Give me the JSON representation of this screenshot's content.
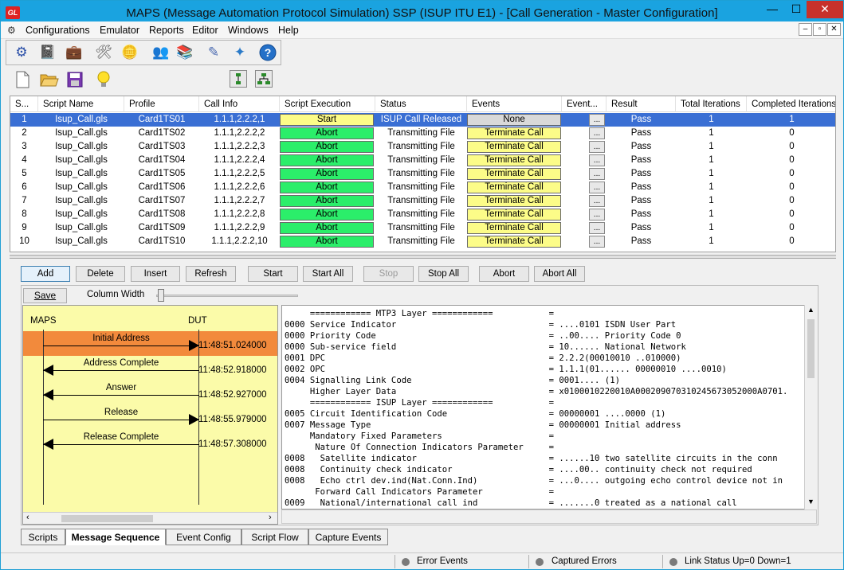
{
  "window": {
    "app_icon": "GL",
    "title": "MAPS (Message Automation Protocol Simulation) SSP (ISUP ITU E1) - [Call Generation - Master Configuration]",
    "min": "—",
    "max": "☐",
    "close": "✕"
  },
  "menu": {
    "items": [
      "Configurations",
      "Emulator",
      "Reports",
      "Editor",
      "Windows",
      "Help"
    ],
    "mdi": [
      "–",
      "▫",
      "✕"
    ]
  },
  "toolbar1": [
    "gear-icon",
    "notebook-icon",
    "briefcase-icon",
    "tools-icon",
    "coins-icon",
    "users-icon",
    "books-icon",
    "edit-icon",
    "wizard-icon",
    "help-icon"
  ],
  "toolbar2": [
    "new-file-icon",
    "open-folder-icon",
    "save-icon",
    "lightbulb-icon",
    "tree-single-icon",
    "tree-multi-icon"
  ],
  "grid": {
    "headers": [
      "S...",
      "Script Name",
      "Profile",
      "Call Info",
      "Script Execution",
      "Status",
      "Events",
      "Event...",
      "Result",
      "Total Iterations",
      "Completed Iterations"
    ],
    "rows": [
      {
        "s": "1",
        "script": "Isup_Call.gls",
        "profile": "Card1TS01",
        "call": "1.1.1,2.2.2,1",
        "exec": "Start",
        "status": "ISUP Call Released",
        "events": "None",
        "dots": "...",
        "result": "Pass",
        "total": "1",
        "completed": "1"
      },
      {
        "s": "2",
        "script": "Isup_Call.gls",
        "profile": "Card1TS02",
        "call": "1.1.1,2.2.2,2",
        "exec": "Abort",
        "status": "Transmitting File",
        "events": "Terminate Call",
        "dots": "...",
        "result": "Pass",
        "total": "1",
        "completed": "0"
      },
      {
        "s": "3",
        "script": "Isup_Call.gls",
        "profile": "Card1TS03",
        "call": "1.1.1,2.2.2,3",
        "exec": "Abort",
        "status": "Transmitting File",
        "events": "Terminate Call",
        "dots": "...",
        "result": "Pass",
        "total": "1",
        "completed": "0"
      },
      {
        "s": "4",
        "script": "Isup_Call.gls",
        "profile": "Card1TS04",
        "call": "1.1.1,2.2.2,4",
        "exec": "Abort",
        "status": "Transmitting File",
        "events": "Terminate Call",
        "dots": "...",
        "result": "Pass",
        "total": "1",
        "completed": "0"
      },
      {
        "s": "5",
        "script": "Isup_Call.gls",
        "profile": "Card1TS05",
        "call": "1.1.1,2.2.2,5",
        "exec": "Abort",
        "status": "Transmitting File",
        "events": "Terminate Call",
        "dots": "...",
        "result": "Pass",
        "total": "1",
        "completed": "0"
      },
      {
        "s": "6",
        "script": "Isup_Call.gls",
        "profile": "Card1TS06",
        "call": "1.1.1,2.2.2,6",
        "exec": "Abort",
        "status": "Transmitting File",
        "events": "Terminate Call",
        "dots": "...",
        "result": "Pass",
        "total": "1",
        "completed": "0"
      },
      {
        "s": "7",
        "script": "Isup_Call.gls",
        "profile": "Card1TS07",
        "call": "1.1.1,2.2.2,7",
        "exec": "Abort",
        "status": "Transmitting File",
        "events": "Terminate Call",
        "dots": "...",
        "result": "Pass",
        "total": "1",
        "completed": "0"
      },
      {
        "s": "8",
        "script": "Isup_Call.gls",
        "profile": "Card1TS08",
        "call": "1.1.1,2.2.2,8",
        "exec": "Abort",
        "status": "Transmitting File",
        "events": "Terminate Call",
        "dots": "...",
        "result": "Pass",
        "total": "1",
        "completed": "0"
      },
      {
        "s": "9",
        "script": "Isup_Call.gls",
        "profile": "Card1TS09",
        "call": "1.1.1,2.2.2,9",
        "exec": "Abort",
        "status": "Transmitting File",
        "events": "Terminate Call",
        "dots": "...",
        "result": "Pass",
        "total": "1",
        "completed": "0"
      },
      {
        "s": "10",
        "script": "Isup_Call.gls",
        "profile": "Card1TS10",
        "call": "1.1.1,2.2.2,10",
        "exec": "Abort",
        "status": "Transmitting File",
        "events": "Terminate Call",
        "dots": "...",
        "result": "Pass",
        "total": "1",
        "completed": "0"
      }
    ]
  },
  "actions": {
    "add": "Add",
    "delete": "Delete",
    "insert": "Insert",
    "refresh": "Refresh",
    "start": "Start",
    "start_all": "Start All",
    "stop": "Stop",
    "stop_all": "Stop All",
    "abort": "Abort",
    "abort_all": "Abort All"
  },
  "lower": {
    "save": "Save",
    "column_width": "Column Width",
    "column_width_level": 0.05,
    "maps": "MAPS",
    "dut": "DUT",
    "messages": [
      {
        "label": "Initial Address",
        "time": "11:48:51.024000",
        "dir": "right"
      },
      {
        "label": "Address Complete",
        "time": "11:48:52.918000",
        "dir": "left"
      },
      {
        "label": "Answer",
        "time": "11:48:52.927000",
        "dir": "left"
      },
      {
        "label": "Release",
        "time": "11:48:55.979000",
        "dir": "right"
      },
      {
        "label": "Release Complete",
        "time": "11:48:57.308000",
        "dir": "left"
      }
    ],
    "decode": [
      "     ============ MTP3 Layer ============           =",
      "0000 Service Indicator                              = ....0101 ISDN User Part",
      "0000 Priority Code                                  = ..00.... Priority Code 0",
      "0000 Sub-service field                              = 10...... National Network",
      "0001 DPC                                            = 2.2.2(00010010 ..010000)",
      "0002 OPC                                            = 1.1.1(01...... 00000010 ....0010)",
      "0004 Signalling Link Code                           = 0001.... (1)",
      "     Higher Layer Data                              = x0100010220010A000209070310245673052000A0701.",
      "     ============ ISUP Layer ============           =",
      "0005 Circuit Identification Code                    = 00000001 ....0000 (1)",
      "0007 Message Type                                   = 00000001 Initial address",
      "     Mandatory Fixed Parameters                     =",
      "      Nature Of Connection Indicators Parameter     =",
      "0008   Satellite indicator                          = ......10 two satellite circuits in the conn",
      "0008   Continuity check indicator                   = ....00.. continuity check not required",
      "0008   Echo ctrl dev.ind(Nat.Conn.Ind)              = ...0.... outgoing echo control device not in",
      "      Forward Call Indicators Parameter             =",
      "0009   National/international call ind              = .......0 treated as a national call"
    ]
  },
  "tabs": [
    "Scripts",
    "Message Sequence",
    "Event Config",
    "Script Flow",
    "Capture Events"
  ],
  "status": {
    "error_events": "Error Events",
    "captured_errors": "Captured Errors",
    "link_status": "Link Status Up=0 Down=1"
  }
}
